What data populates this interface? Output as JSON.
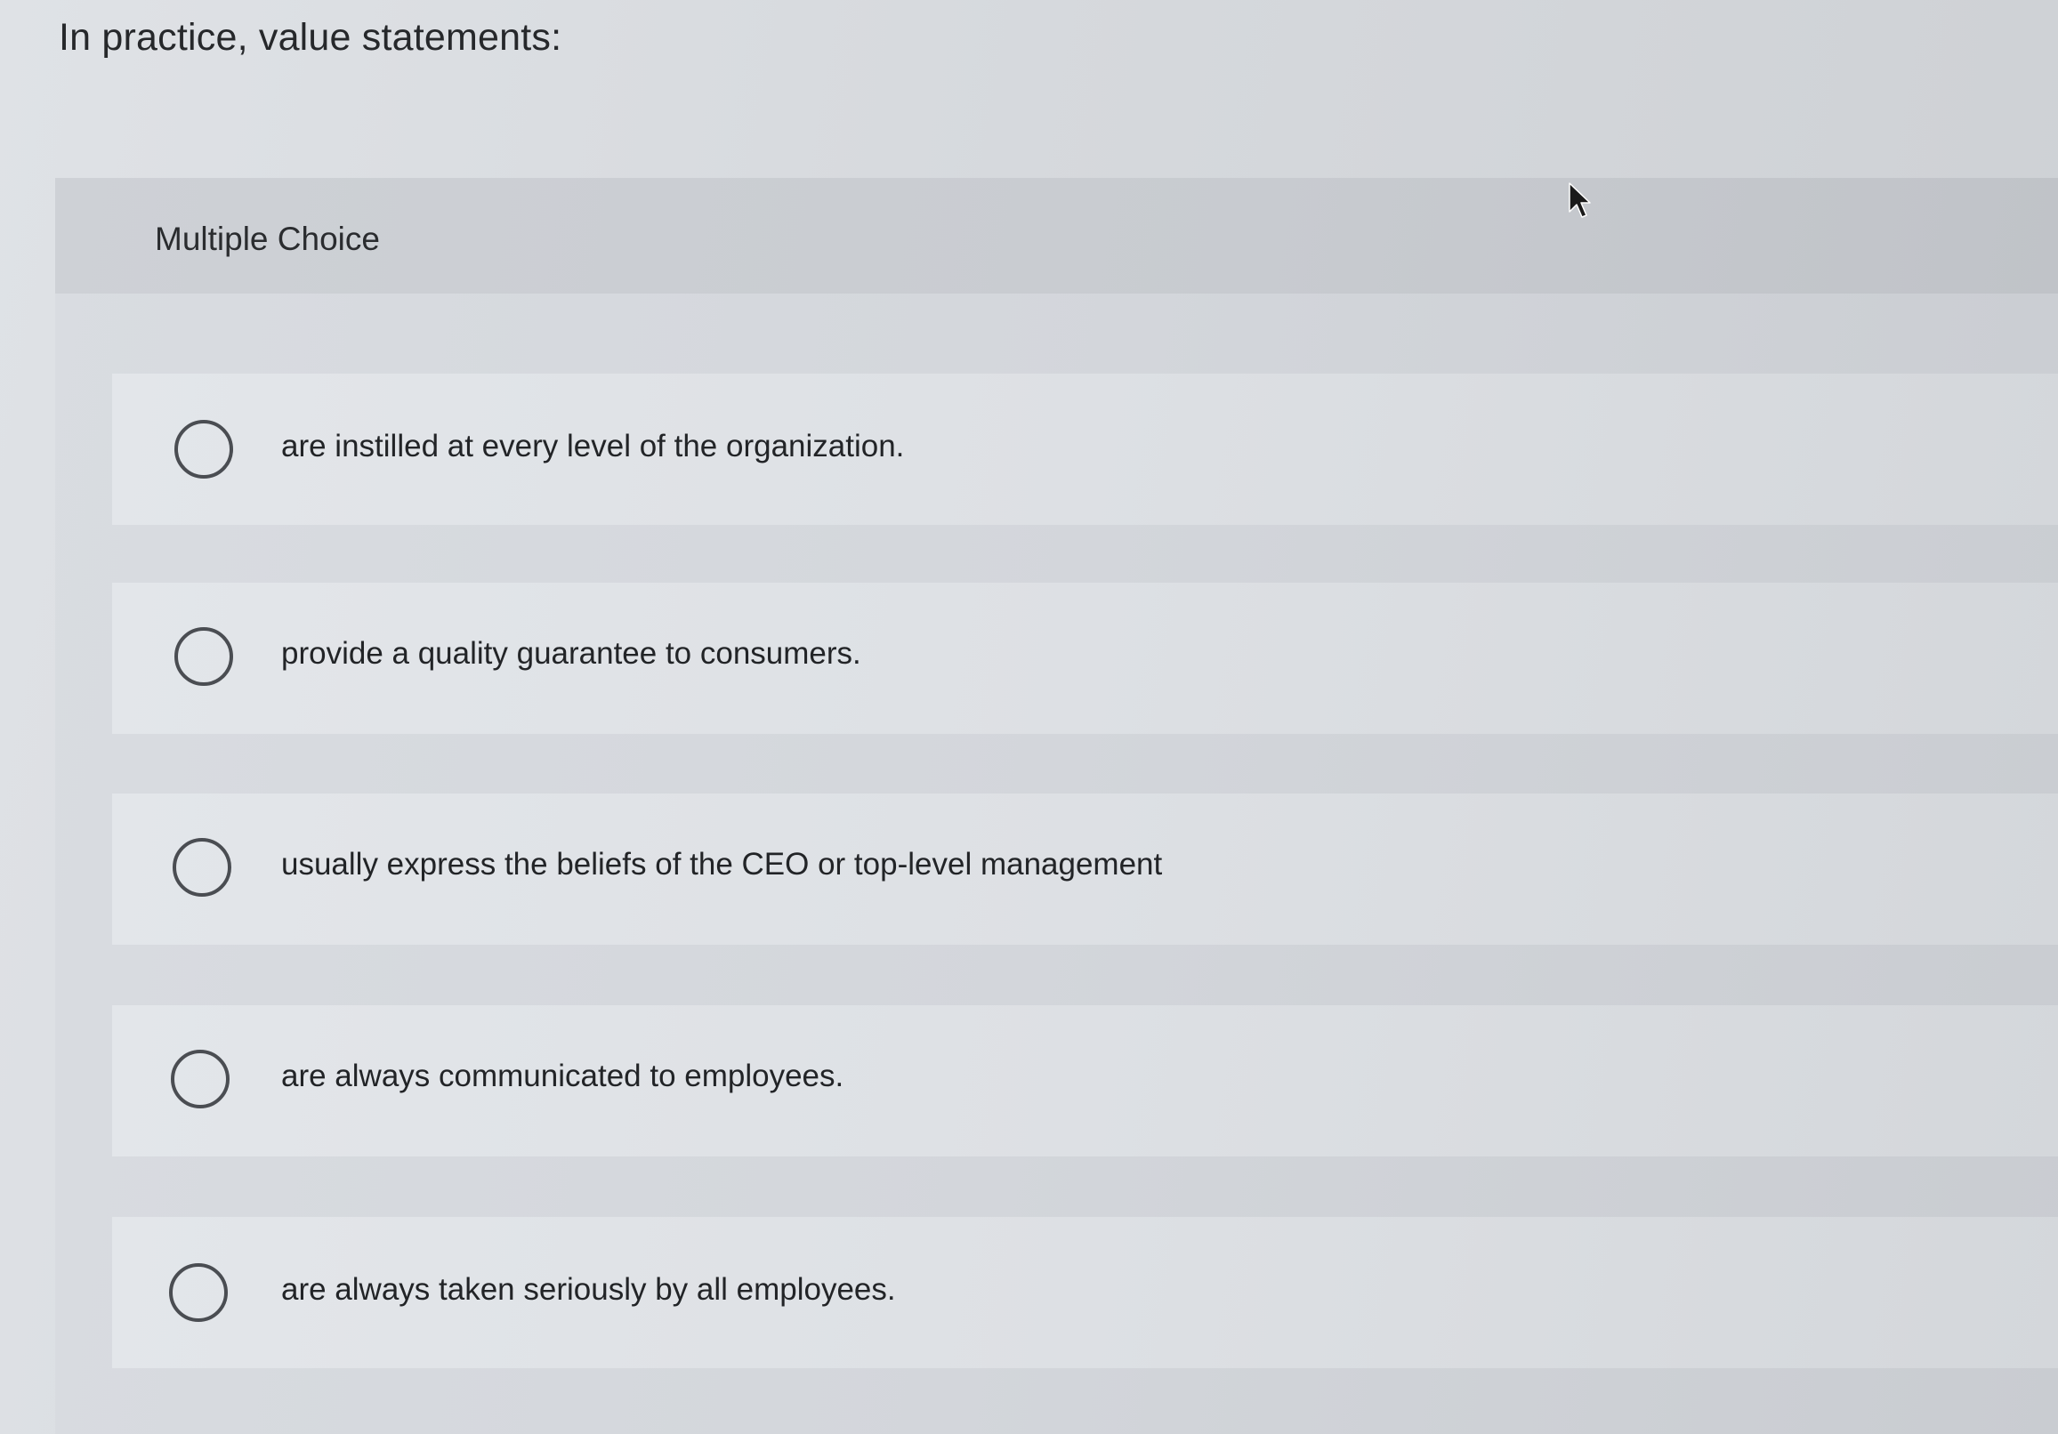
{
  "question": {
    "text": "In practice, value statements:"
  },
  "multiple_choice": {
    "label": "Multiple Choice",
    "options": [
      {
        "label": "are instilled at every level of the organization.",
        "selected": false
      },
      {
        "label": "provide a quality guarantee to consumers.",
        "selected": false
      },
      {
        "label": "usually express the beliefs of the CEO or top-level management",
        "selected": false
      },
      {
        "label": "are always communicated to employees.",
        "selected": false
      },
      {
        "label": "are always taken seriously by all employees.",
        "selected": false
      }
    ]
  },
  "icons": {
    "cursor": "mouse-pointer-icon",
    "radio": "radio-circle-icon"
  }
}
